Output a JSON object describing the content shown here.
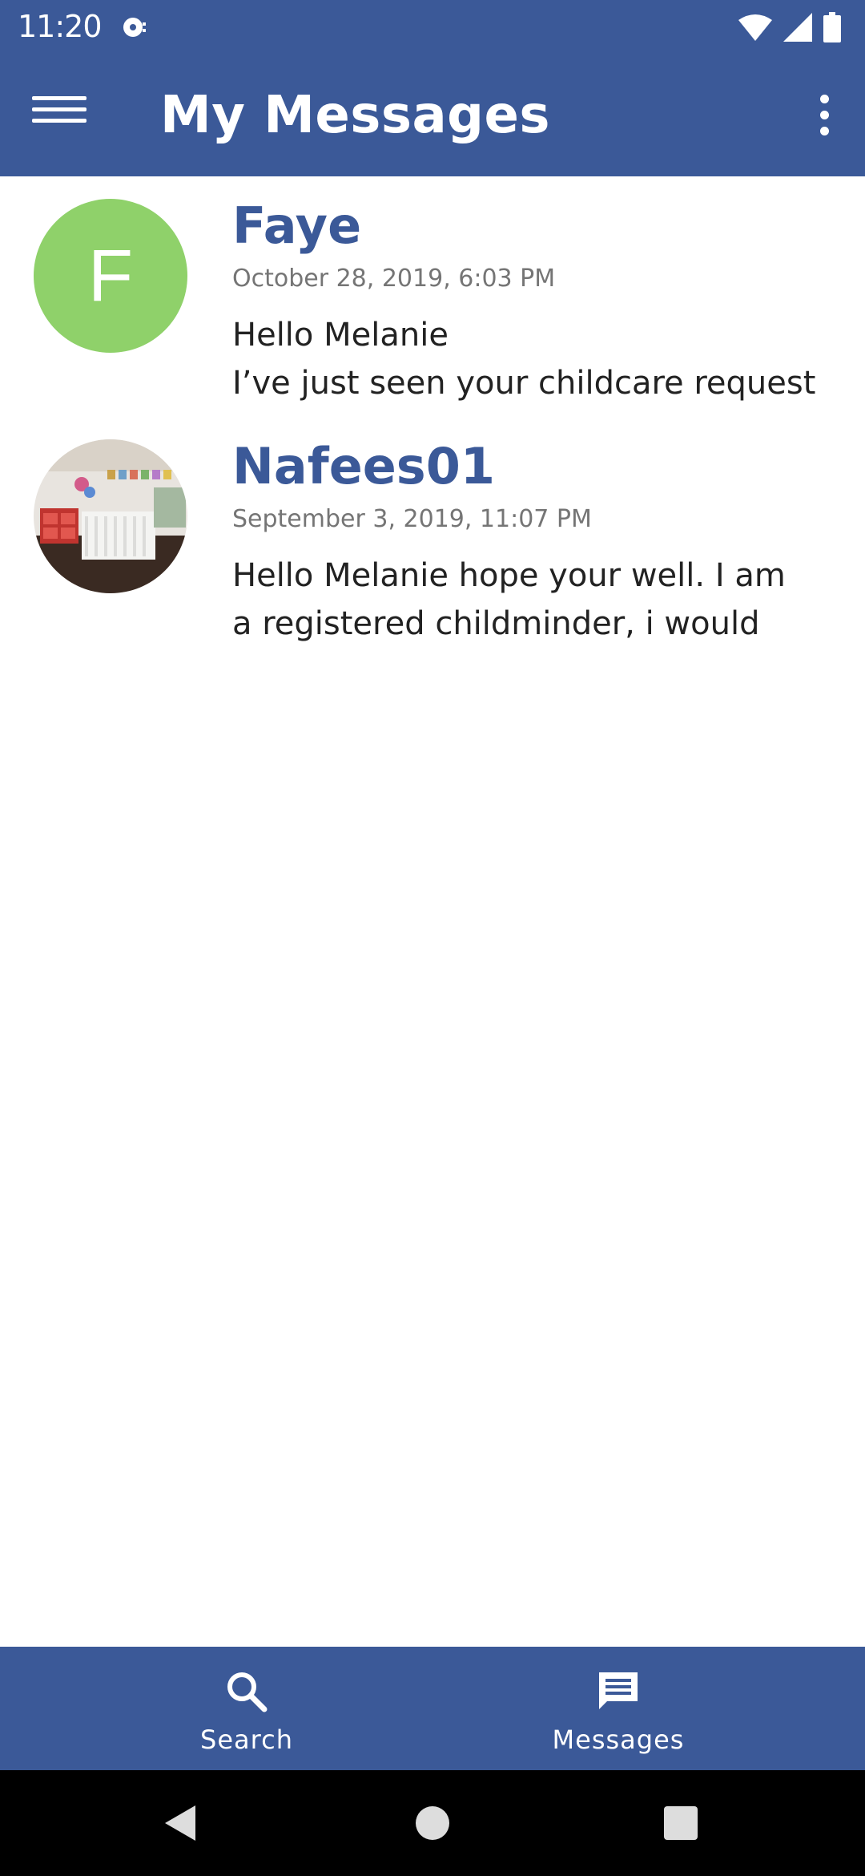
{
  "status_bar": {
    "time": "11:20"
  },
  "app_bar": {
    "title": "My Messages"
  },
  "messages": [
    {
      "avatar_letter": "F",
      "name": "Faye",
      "date": "October 28, 2019, 6:03 PM",
      "preview": "Hello Melanie\nI’ve just seen your childcare request"
    },
    {
      "avatar_letter": "",
      "name": "Nafees01",
      "date": "September 3, 2019, 11:07 PM",
      "preview": "Hello Melanie hope your well. I am\na registered childminder, i would"
    }
  ],
  "bottom_nav": {
    "items": [
      {
        "label": "Search",
        "icon": "search-icon"
      },
      {
        "label": "Messages",
        "icon": "chat-icon"
      }
    ]
  },
  "colors": {
    "primary": "#3b5998",
    "avatar_green": "#8fd16a",
    "date_gray": "#757575"
  }
}
